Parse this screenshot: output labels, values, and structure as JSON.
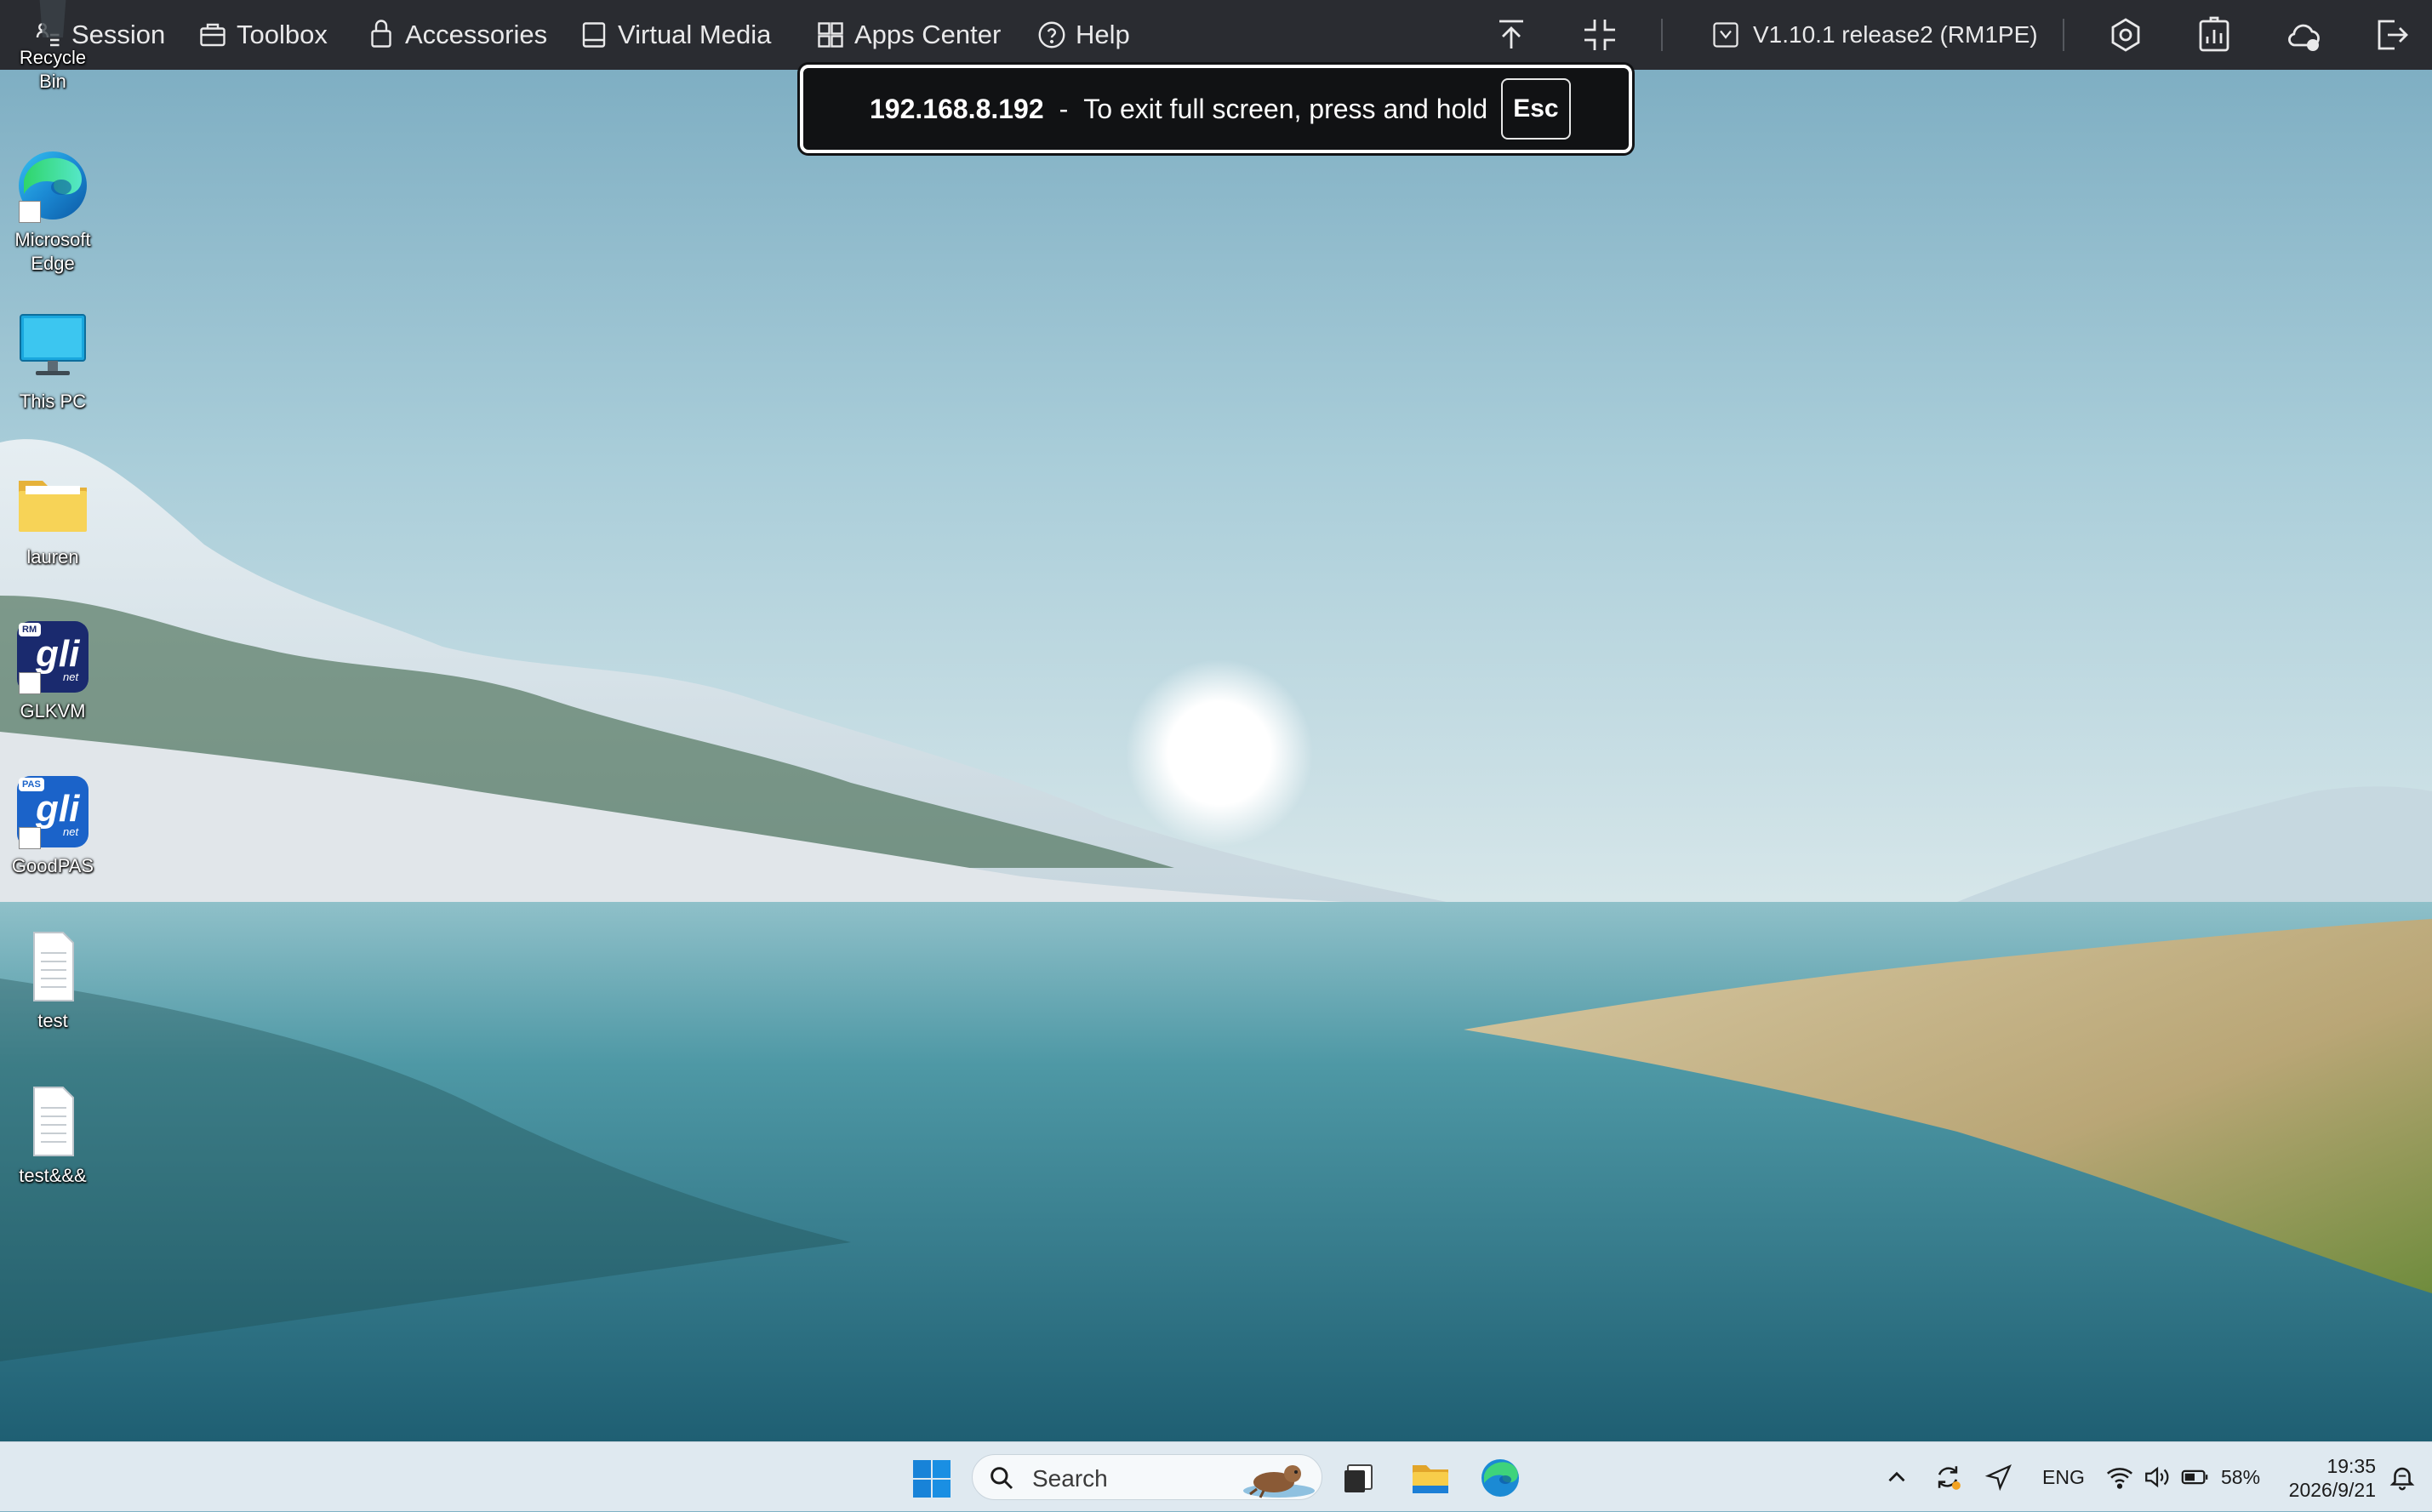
{
  "kvm_toolbar": {
    "menu": [
      {
        "label": "Session",
        "icon": "session-icon"
      },
      {
        "label": "Toolbox",
        "icon": "toolbox-icon"
      },
      {
        "label": "Accessories",
        "icon": "accessories-icon"
      },
      {
        "label": "Virtual Media",
        "icon": "virtual-media-icon"
      },
      {
        "label": "Apps Center",
        "icon": "apps-center-icon"
      },
      {
        "label": "Help",
        "icon": "help-icon"
      }
    ],
    "version": "V1.10.1 release2 (RM1PE)",
    "colors": {
      "background": "#2a2c31",
      "text": "#e9e9ea"
    }
  },
  "fullscreen_notice": {
    "ip": "192.168.8.192",
    "separator": "-",
    "message": "To exit full screen, press and hold",
    "key": "Esc"
  },
  "desktop": {
    "icons": [
      {
        "label": "Recycle Bin",
        "icon": "recycle-bin-icon"
      },
      {
        "label": "Microsoft Edge",
        "icon": "edge-icon"
      },
      {
        "label": "This PC",
        "icon": "this-pc-icon"
      },
      {
        "label": "lauren",
        "icon": "folder-icon"
      },
      {
        "label": "GLKVM",
        "icon": "glkvm-icon",
        "badge": "RM"
      },
      {
        "label": "GoodPAS",
        "icon": "goodpas-icon",
        "badge": "PAS"
      },
      {
        "label": "test",
        "icon": "text-file-icon"
      },
      {
        "label": "test&&&",
        "icon": "text-file-icon"
      }
    ],
    "app_logo_text": "gli",
    "app_logo_subtext": "net"
  },
  "taskbar": {
    "search_placeholder": "Search",
    "apps": [
      "start-icon",
      "task-view-icon",
      "file-explorer-icon",
      "edge-icon"
    ],
    "tray": {
      "language": "ENG",
      "battery": "58%",
      "time": "19:35",
      "date": "2026/9/21"
    }
  }
}
